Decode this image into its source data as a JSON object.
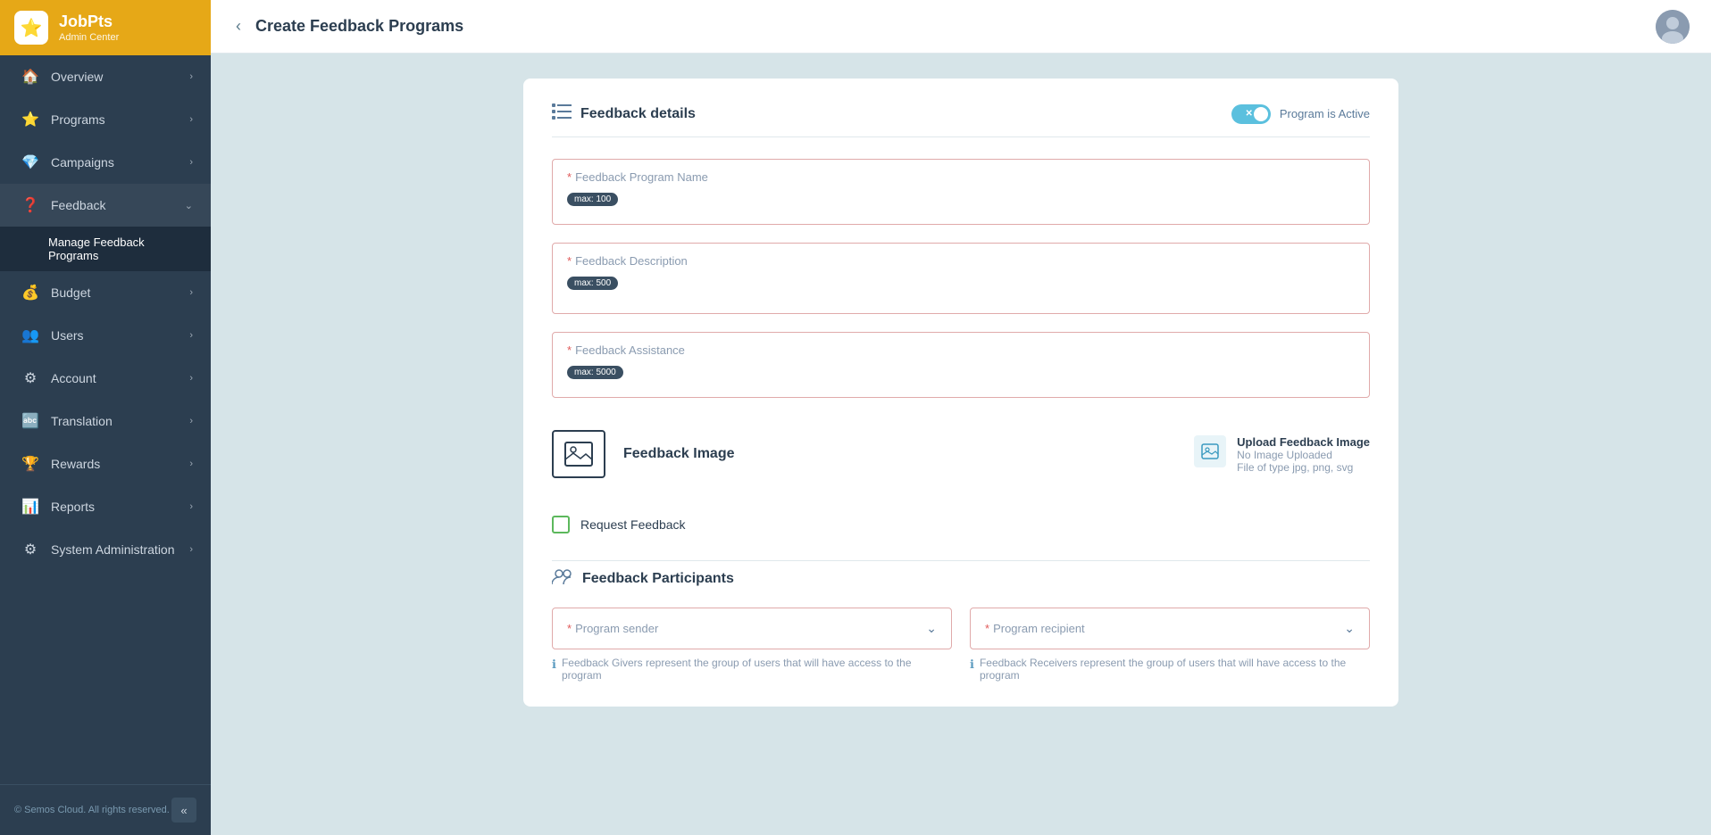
{
  "app": {
    "logo_icon": "⭐",
    "title": "JobPts",
    "subtitle": "Admin Center"
  },
  "sidebar": {
    "items": [
      {
        "id": "overview",
        "label": "Overview",
        "icon": "🏠",
        "has_chevron": true
      },
      {
        "id": "programs",
        "label": "Programs",
        "icon": "⭐",
        "has_chevron": true
      },
      {
        "id": "campaigns",
        "label": "Campaigns",
        "icon": "💎",
        "has_chevron": true
      },
      {
        "id": "feedback",
        "label": "Feedback",
        "icon": "❓",
        "has_chevron": true,
        "expanded": true
      },
      {
        "id": "budget",
        "label": "Budget",
        "icon": "💰",
        "has_chevron": true
      },
      {
        "id": "users",
        "label": "Users",
        "icon": "👥",
        "has_chevron": true
      },
      {
        "id": "account",
        "label": "Account",
        "icon": "⚙",
        "has_chevron": true
      },
      {
        "id": "translation",
        "label": "Translation",
        "icon": "🔤",
        "has_chevron": true
      },
      {
        "id": "rewards",
        "label": "Rewards",
        "icon": "🏆",
        "has_chevron": true
      },
      {
        "id": "reports",
        "label": "Reports",
        "icon": "📊",
        "has_chevron": true
      },
      {
        "id": "system-administration",
        "label": "System Administration",
        "icon": "⚙",
        "has_chevron": true
      }
    ],
    "submenu": {
      "feedback": [
        {
          "id": "manage-feedback-programs",
          "label": "Manage Feedback Programs",
          "active": true
        }
      ]
    },
    "footer": {
      "copyright": "© Semos Cloud. All rights reserved."
    },
    "collapse_icon": "«"
  },
  "topbar": {
    "back_label": "‹",
    "title": "Create Feedback Programs"
  },
  "form": {
    "sections": {
      "feedback_details": {
        "title": "Feedback details",
        "toggle_label": "Program is Active",
        "fields": {
          "name": {
            "label": "Feedback Program Name",
            "badge": "max: 100",
            "required": true,
            "placeholder": ""
          },
          "description": {
            "label": "Feedback Description",
            "badge": "max: 500",
            "required": true,
            "placeholder": ""
          },
          "assistance": {
            "label": "Feedback Assistance",
            "badge": "max: 5000",
            "required": true,
            "placeholder": ""
          }
        },
        "image": {
          "label": "Feedback Image",
          "upload_title": "Upload Feedback Image",
          "upload_no_image": "No Image Uploaded",
          "upload_file_types": "File of type jpg, png, svg"
        },
        "request_feedback": {
          "label": "Request Feedback"
        }
      },
      "feedback_participants": {
        "title": "Feedback Participants",
        "sender_label": "Program sender",
        "recipient_label": "Program recipient",
        "sender_required": true,
        "recipient_required": true,
        "sender_info": "Feedback Givers represent the group of users that will have access to the program",
        "recipient_info": "Feedback Receivers represent the group of users that will have access to the program"
      }
    }
  }
}
